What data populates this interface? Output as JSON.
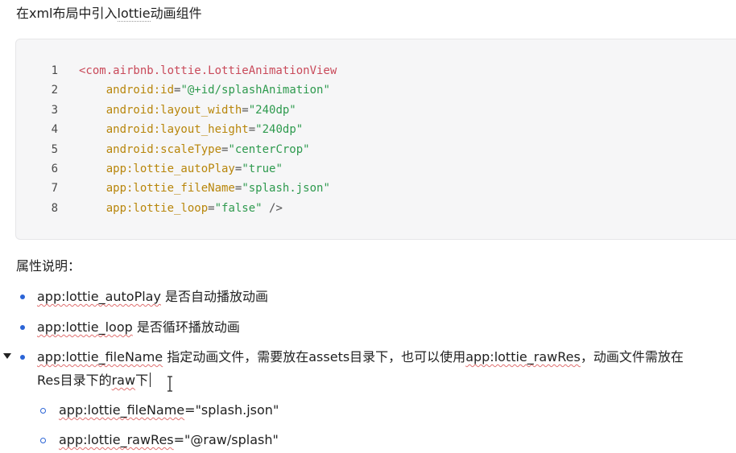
{
  "heading": {
    "prefix": "在xml布局中引入",
    "highlight": "lottie",
    "suffix": "动画组件"
  },
  "code": {
    "lines": [
      {
        "num": "1",
        "indent": "",
        "tag": "<com.airbnb.lottie.LottieAnimationView",
        "attr": "",
        "eq": "",
        "val": "",
        "end": ""
      },
      {
        "num": "2",
        "indent": "    ",
        "tag": "",
        "attr": "android:id",
        "eq": "=",
        "val": "\"@+id/splashAnimation\"",
        "end": ""
      },
      {
        "num": "3",
        "indent": "    ",
        "tag": "",
        "attr": "android:layout_width",
        "eq": "=",
        "val": "\"240dp\"",
        "end": ""
      },
      {
        "num": "4",
        "indent": "    ",
        "tag": "",
        "attr": "android:layout_height",
        "eq": "=",
        "val": "\"240dp\"",
        "end": ""
      },
      {
        "num": "5",
        "indent": "    ",
        "tag": "",
        "attr": "android:scaleType",
        "eq": "=",
        "val": "\"centerCrop\"",
        "end": ""
      },
      {
        "num": "6",
        "indent": "    ",
        "tag": "",
        "attr": "app:lottie_autoPlay",
        "eq": "=",
        "val": "\"true\"",
        "end": ""
      },
      {
        "num": "7",
        "indent": "    ",
        "tag": "",
        "attr": "app:lottie_fileName",
        "eq": "=",
        "val": "\"splash.json\"",
        "end": ""
      },
      {
        "num": "8",
        "indent": "    ",
        "tag": "",
        "attr": "app:lottie_loop",
        "eq": "=",
        "val": "\"false\"",
        "end": " />"
      }
    ]
  },
  "section": {
    "label": "属性说明："
  },
  "bullets": {
    "b1": {
      "key": "app:lottie_autoPlay",
      "text": " 是否自动播放动画"
    },
    "b2": {
      "key": "app:lottie_loop",
      "text": " 是否循环播放动画"
    },
    "b3": {
      "key": "app:lottie_fileName",
      "text": " 指定动画文件，需要放在assets目录下，也可以使用",
      "key2": "app:lottie_rawRes",
      "text2": "，动画文件需放在",
      "line2a": "Res目录下的",
      "line2b": "raw",
      "line2c": "下"
    },
    "sub1": {
      "key": "app:lottie_fileName",
      "text": "=\"splash.json\""
    },
    "sub2": {
      "key": "app:lottie_rawRes",
      "text": "=\"@raw/splash\""
    }
  },
  "colors": {
    "accent": "#2b64d6",
    "tag": "#c94a5a",
    "attr": "#b8860b",
    "string": "#2e9a4e"
  }
}
